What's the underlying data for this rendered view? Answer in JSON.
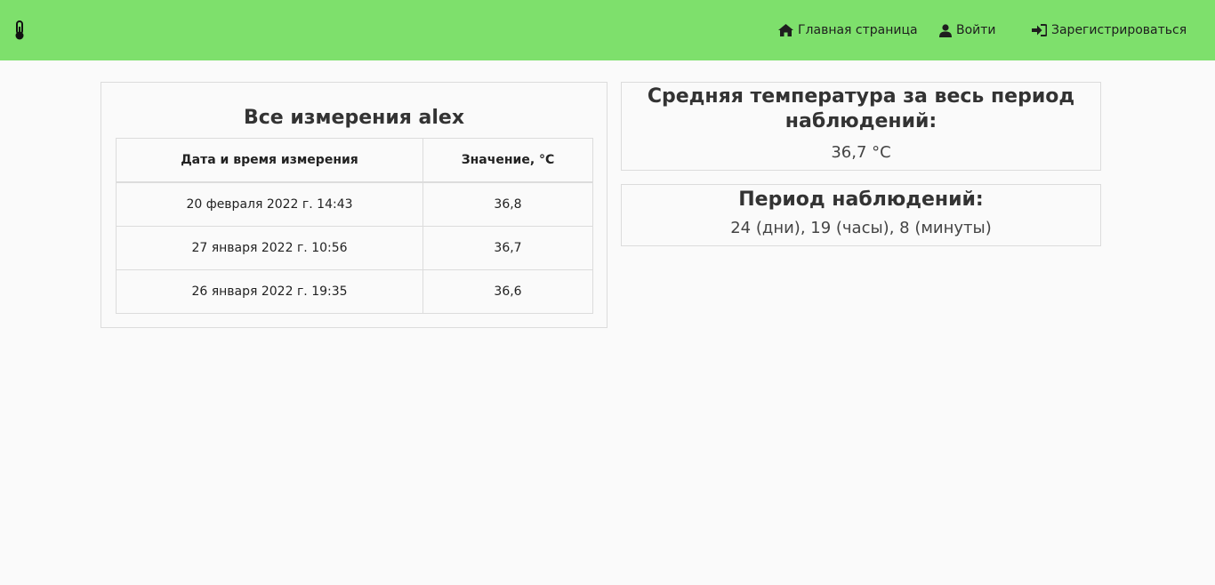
{
  "nav": {
    "brand_icon": "thermometer-icon",
    "home_label": "Главная страница",
    "login_label": "Войти",
    "register_label": "Зарегистрироваться",
    "home_icon": "home-icon",
    "login_icon": "user-icon",
    "register_icon": "sign-in-icon"
  },
  "colors": {
    "navbar": "#7ee06c",
    "background": "#fafafa"
  },
  "measurements": {
    "title": "Все измерения alex",
    "headers": [
      "Дата и время измерения",
      "Значение, °C"
    ],
    "rows": [
      [
        "20 февраля 2022 г. 14:43",
        "36,8"
      ],
      [
        "27 января 2022 г. 10:56",
        "36,7"
      ],
      [
        "26 января 2022 г. 19:35",
        "36,6"
      ]
    ]
  },
  "average": {
    "title": "Средняя температура за весь период наблюдений:",
    "value": "36,7 °C"
  },
  "period": {
    "title": "Период наблюдений:",
    "value": "24 (дни), 19 (часы), 8 (минуты)"
  }
}
